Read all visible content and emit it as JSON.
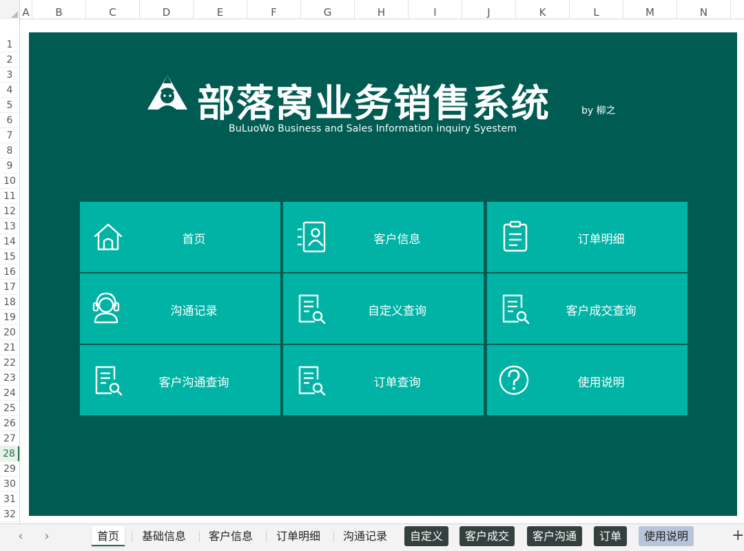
{
  "columns": [
    "A",
    "B",
    "C",
    "D",
    "E",
    "F",
    "G",
    "H",
    "I",
    "J",
    "K",
    "L",
    "M",
    "N"
  ],
  "rows": [
    "1",
    "2",
    "3",
    "4",
    "5",
    "6",
    "7",
    "8",
    "9",
    "10",
    "11",
    "12",
    "13",
    "14",
    "15",
    "16",
    "17",
    "18",
    "19",
    "20",
    "21",
    "22",
    "23",
    "24",
    "25",
    "26",
    "27",
    "28",
    "29",
    "30",
    "31",
    "32"
  ],
  "active_row": "28",
  "header": {
    "title": "部落窝业务销售系统",
    "byline": "by 柳之",
    "subtitle": "BuLuoWo Business and Sales Information inquiry Syestem"
  },
  "tiles": [
    {
      "label": "首页",
      "icon": "home-icon"
    },
    {
      "label": "客户信息",
      "icon": "contact-card-icon"
    },
    {
      "label": "订单明细",
      "icon": "clipboard-icon"
    },
    {
      "label": "沟通记录",
      "icon": "headset-icon"
    },
    {
      "label": "自定义查询",
      "icon": "document-search-icon"
    },
    {
      "label": "客户成交查询",
      "icon": "document-search-icon"
    },
    {
      "label": "客户沟通查询",
      "icon": "document-search-icon"
    },
    {
      "label": "订单查询",
      "icon": "document-search-icon"
    },
    {
      "label": "使用说明",
      "icon": "help-icon"
    }
  ],
  "sheet_tabs": [
    "首页",
    "基础信息",
    "客户信息",
    "订单明细",
    "沟通记录",
    "自定义",
    "客户成交",
    "客户沟通",
    "订单",
    "使用说明"
  ],
  "nav": {
    "prev": "‹",
    "next": "›",
    "add": "+"
  },
  "colors": {
    "background": "#005c53",
    "tile": "#00b3a5",
    "active_tab_accent": "#217346"
  }
}
